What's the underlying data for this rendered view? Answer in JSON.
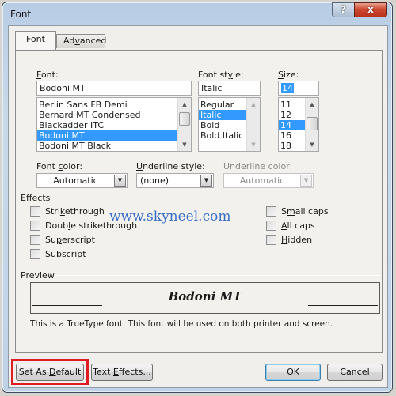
{
  "window": {
    "title": "Font",
    "help_label": "?",
    "close_label": "x"
  },
  "tabs": [
    {
      "label_pre": "Fo",
      "mnemonic": "n",
      "label_post": "t",
      "selected": true
    },
    {
      "label_pre": "Ad",
      "mnemonic": "v",
      "label_post": "anced",
      "selected": false
    }
  ],
  "font": {
    "label_mnemonic": "F",
    "label_rest": "ont:",
    "value": "Bodoni MT",
    "items": [
      "Berlin Sans FB Demi",
      "Bernard MT Condensed",
      "Blackadder ITC",
      "Bodoni MT",
      "Bodoni MT Black"
    ],
    "selected_index": 3
  },
  "font_style": {
    "label_pre": "Font st",
    "label_mnemonic": "y",
    "label_post": "le:",
    "value": "Italic",
    "items": [
      "Regular",
      "Italic",
      "Bold",
      "Bold Italic"
    ],
    "selected_index": 1
  },
  "size": {
    "label_mnemonic": "S",
    "label_rest": "ize:",
    "value": "14",
    "items": [
      "11",
      "12",
      "14",
      "16",
      "18"
    ],
    "selected_index": 2
  },
  "font_color": {
    "label_pre": "Font ",
    "label_mnemonic": "c",
    "label_post": "olor:",
    "value": "Automatic"
  },
  "underline_style": {
    "label_mnemonic": "U",
    "label_rest": "nderline style:",
    "value": "(none)"
  },
  "underline_color": {
    "label": "Underline color:",
    "value": "Automatic",
    "disabled": true
  },
  "effects": {
    "label": "Effects",
    "left": [
      {
        "pre": "Stri",
        "mn": "k",
        "post": "ethrough",
        "checked": false
      },
      {
        "pre": "Doub",
        "mn": "l",
        "post": "e strikethrough",
        "checked": false
      },
      {
        "pre": "Su",
        "mn": "p",
        "post": "erscript",
        "checked": false
      },
      {
        "pre": "Su",
        "mn": "b",
        "post": "script",
        "checked": false
      }
    ],
    "right": [
      {
        "pre": "S",
        "mn": "m",
        "post": "all caps",
        "checked": false
      },
      {
        "pre": "",
        "mn": "A",
        "post": "ll caps",
        "checked": false
      },
      {
        "pre": "",
        "mn": "H",
        "post": "idden",
        "checked": false
      }
    ]
  },
  "watermark": "www.skyneel.com",
  "preview": {
    "label": "Preview",
    "sample_text": "Bodoni MT",
    "note": "This is a TrueType font. This font will be used on both printer and screen."
  },
  "buttons": {
    "set_default": {
      "pre": "Set As ",
      "mn": "D",
      "post": "efault"
    },
    "text_effects": {
      "pre": "Text ",
      "mn": "E",
      "post": "ffects..."
    },
    "ok": "OK",
    "cancel": "Cancel"
  },
  "colors": {
    "selection": "#3399ff",
    "highlight_box": "#e01b24",
    "watermark": "#3a6fc7",
    "close_button": "#c8402a"
  }
}
